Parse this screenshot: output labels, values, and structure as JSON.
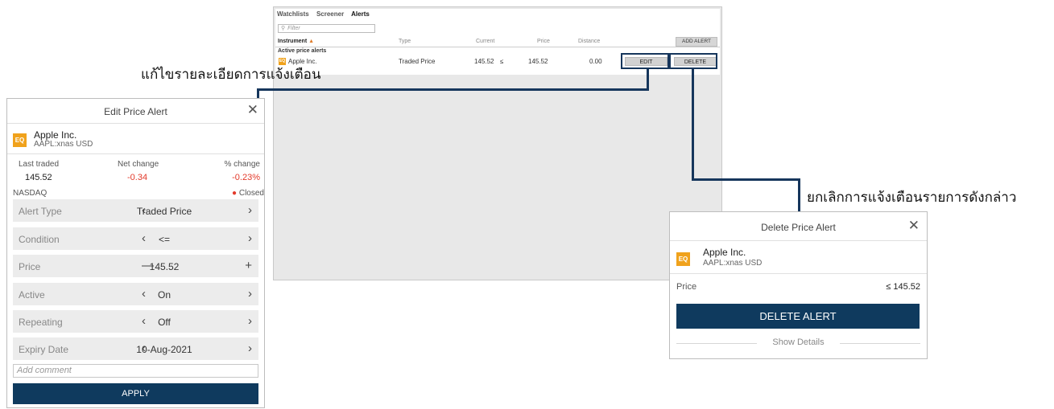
{
  "alerts_panel": {
    "tabs": [
      "Watchlists",
      "Screener",
      "Alerts"
    ],
    "filter_placeholder": "Filter",
    "columns": {
      "instrument": "Instrument",
      "sort_indicator": "▲",
      "type": "Type",
      "current": "Current",
      "price": "Price",
      "distance": "Distance"
    },
    "add_alert_label": "ADD ALERT",
    "section_label": "Active price alerts",
    "row": {
      "badge": "EQ",
      "instrument": "Apple Inc.",
      "type": "Traded Price",
      "current": "145.52",
      "operator": "≤",
      "price": "145.52",
      "distance": "0.00",
      "edit_label": "EDIT",
      "delete_label": "DELETE"
    }
  },
  "callouts": {
    "edit": "แก้ไขรายละเอียดการแจ้งเตือน",
    "delete": "ยกเลิกการแจ้งเตือนรายการดังกล่าว"
  },
  "edit_modal": {
    "title": "Edit Price Alert",
    "badge": "EQ",
    "instrument_name": "Apple Inc.",
    "instrument_symbol": "AAPL:xnas USD",
    "stats": {
      "last_traded_label": "Last traded",
      "last_traded_value": "145.52",
      "net_change_label": "Net change",
      "net_change_value": "-0.34",
      "pct_change_label": "% change",
      "pct_change_value": "-0.23%"
    },
    "exchange": "NASDAQ",
    "market_status": "Closed",
    "fields": [
      {
        "label": "Alert Type",
        "value": "Traded Price",
        "left": "‹",
        "right": "›"
      },
      {
        "label": "Condition",
        "value": "<=",
        "left": "‹",
        "right": "›"
      },
      {
        "label": "Price",
        "value": "145.52",
        "left": "—",
        "right": "+"
      },
      {
        "label": "Active",
        "value": "On",
        "left": "‹",
        "right": "›"
      },
      {
        "label": "Repeating",
        "value": "Off",
        "left": "‹",
        "right": "›"
      },
      {
        "label": "Expiry Date",
        "value": "10-Aug-2021",
        "left": "‹",
        "right": "›"
      }
    ],
    "comment_placeholder": "Add comment",
    "apply_label": "APPLY"
  },
  "delete_modal": {
    "title": "Delete Price Alert",
    "badge": "EQ",
    "instrument_name": "Apple Inc.",
    "instrument_symbol": "AAPL:xnas USD",
    "price_label": "Price",
    "price_value": "≤ 145.52",
    "delete_label": "DELETE ALERT",
    "show_details_label": "Show Details"
  }
}
